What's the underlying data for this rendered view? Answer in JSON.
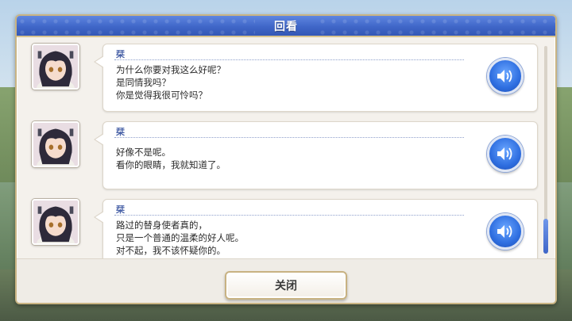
{
  "dialog": {
    "title": "回看",
    "close_label": "关闭"
  },
  "entries": [
    {
      "speaker": "栞",
      "lines": [
        "为什么你要对我这么好呢？",
        "是同情我吗？",
        "你是觉得我很可怜吗？"
      ],
      "voice_icon": "speaker-icon"
    },
    {
      "speaker": "栞",
      "lines": [
        "好像不是呢。",
        "看你的眼睛，我就知道了。"
      ],
      "voice_icon": "speaker-icon"
    },
    {
      "speaker": "栞",
      "lines": [
        "路过的替身使者真的，",
        "只是一个普通的温柔的好人呢。",
        "对不起，我不该怀疑你的。"
      ],
      "voice_icon": "speaker-icon"
    }
  ],
  "colors": {
    "title_bar": "#3f66c8",
    "voice_button": "#2e6ee0",
    "frame_gold": "#c9b483",
    "speaker_name": "#4a63a8"
  },
  "scroll": {
    "position_fraction": 0.95
  }
}
